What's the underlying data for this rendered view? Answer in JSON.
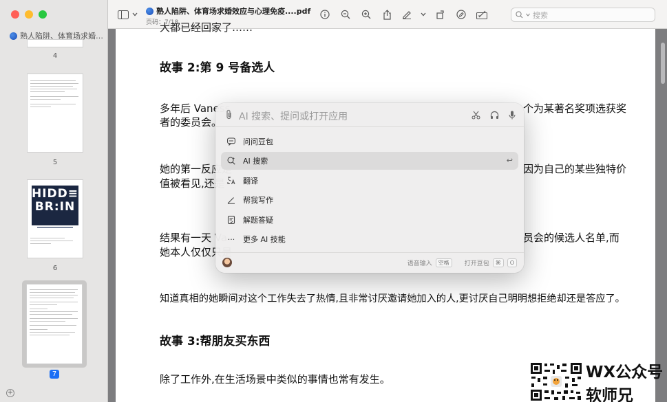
{
  "window": {
    "doc_title": "熟人陷阱、体育场求婚效应与心理免疫....pdf",
    "page_indicator": "页码：7/18",
    "search_placeholder": "搜索"
  },
  "sidebar": {
    "title": "熟人陷阱、体育场求婚效应...",
    "thumbnails": [
      {
        "page": "4"
      },
      {
        "page": "5"
      },
      {
        "page": "6",
        "cover_line1": "HIDD≡N",
        "cover_line2": "BR:IN"
      },
      {
        "page": "7"
      }
    ],
    "selected_page": "7"
  },
  "document": {
    "top_cut": "大都已经回家了……",
    "heading2": "故事 2:第 9 号备选人",
    "para1_left": "多年后 Vaness",
    "para1_right": "个为某著名奖项选获奖",
    "para1_line2": "者的委员会。",
    "para2_left": "她的第一反应是",
    "para2_right": "因为自己的某些独特价",
    "para2_line2": "值被看见,还是",
    "para3_left": "结果有一天 Va",
    "para3_right": "员会的候选人名单,而",
    "para3_line2": "她本人仅仅只是",
    "para4": "知道真相的她瞬间对这个工作失去了热情,且非常讨厌邀请她加入的人,更讨厌自己明明想拒绝却还是答应了。",
    "heading3": "故事 3:帮朋友买东西",
    "para5": "除了工作外,在生活场景中类似的事情也常有发生。"
  },
  "ai_panel": {
    "placeholder": "AI 搜索、提问或打开应用",
    "items": [
      {
        "label": "问问豆包",
        "icon": "chat-bubble-icon"
      },
      {
        "label": "AI 搜索",
        "icon": "ai-search-icon",
        "selected": true
      },
      {
        "label": "翻译",
        "icon": "translate-icon"
      },
      {
        "label": "帮我写作",
        "icon": "pen-icon"
      },
      {
        "label": "解题答疑",
        "icon": "solve-icon"
      },
      {
        "label": "更多 AI 技能",
        "icon": "more-icon"
      }
    ],
    "footer": {
      "voice_label": "语音输入",
      "voice_key": "空格",
      "open_label": "打开豆包",
      "open_key1": "⌘",
      "open_key2": "O"
    }
  },
  "watermark": {
    "line1": "WX公众号",
    "line2": "软师兄"
  },
  "colors": {
    "accent": "#1a6ef5",
    "traffic_red": "#ff5f57",
    "traffic_yellow": "#febc2e",
    "traffic_green": "#28c840",
    "cover_navy": "#1b2741"
  }
}
